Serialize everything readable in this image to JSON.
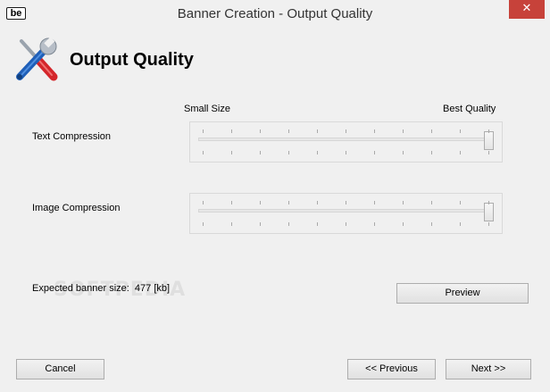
{
  "window": {
    "title": "Banner Creation - Output Quality",
    "app_icon_text": "be",
    "close_glyph": "✕"
  },
  "header": {
    "title": "Output Quality",
    "icon": "wrench-screwdriver-icon"
  },
  "scale_labels": {
    "min": "Small Size",
    "max": "Best Quality"
  },
  "text_compression": {
    "label": "Text Compression",
    "level": 1.0
  },
  "image_compression": {
    "label": "Image Compression",
    "level": 1.0
  },
  "expected_size": {
    "label": "Expected banner size:",
    "value": "477 [kb]"
  },
  "watermark": "SOFTPEDIA",
  "buttons": {
    "preview": "Preview",
    "cancel": "Cancel",
    "previous": "<< Previous",
    "next": "Next >>"
  }
}
